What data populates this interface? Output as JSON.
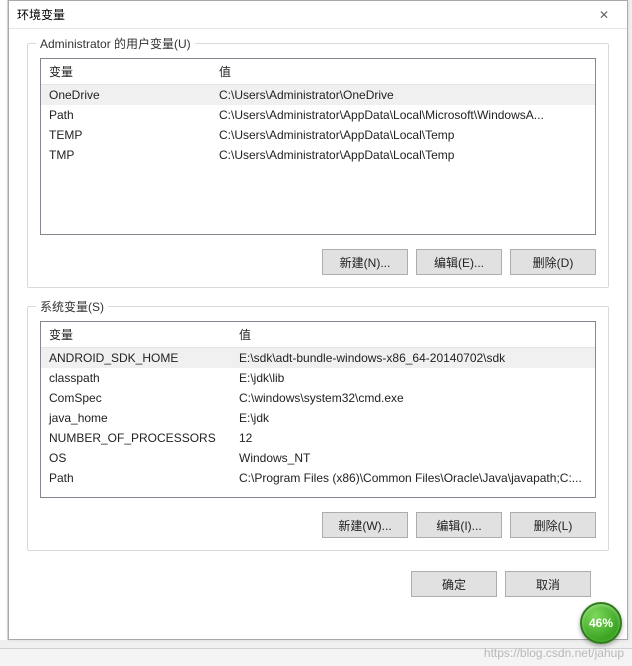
{
  "dialog": {
    "title": "环境变量",
    "close_glyph": "✕"
  },
  "user_section": {
    "legend": "Administrator 的用户变量(U)",
    "col_var": "变量",
    "col_val": "值",
    "rows": [
      {
        "name": "OneDrive",
        "value": "C:\\Users\\Administrator\\OneDrive"
      },
      {
        "name": "Path",
        "value": "C:\\Users\\Administrator\\AppData\\Local\\Microsoft\\WindowsA..."
      },
      {
        "name": "TEMP",
        "value": "C:\\Users\\Administrator\\AppData\\Local\\Temp"
      },
      {
        "name": "TMP",
        "value": "C:\\Users\\Administrator\\AppData\\Local\\Temp"
      }
    ],
    "buttons": {
      "new": "新建(N)...",
      "edit": "编辑(E)...",
      "delete": "删除(D)"
    }
  },
  "system_section": {
    "legend": "系统变量(S)",
    "col_var": "变量",
    "col_val": "值",
    "rows": [
      {
        "name": "ANDROID_SDK_HOME",
        "value": "E:\\sdk\\adt-bundle-windows-x86_64-20140702\\sdk"
      },
      {
        "name": "classpath",
        "value": "E:\\jdk\\lib"
      },
      {
        "name": "ComSpec",
        "value": "C:\\windows\\system32\\cmd.exe"
      },
      {
        "name": "java_home",
        "value": "E:\\jdk"
      },
      {
        "name": "NUMBER_OF_PROCESSORS",
        "value": "12"
      },
      {
        "name": "OS",
        "value": "Windows_NT"
      },
      {
        "name": "Path",
        "value": "C:\\Program Files (x86)\\Common Files\\Oracle\\Java\\javapath;C:..."
      }
    ],
    "buttons": {
      "new": "新建(W)...",
      "edit": "编辑(I)...",
      "delete": "删除(L)"
    }
  },
  "footer": {
    "ok": "确定",
    "cancel": "取消"
  },
  "badge": "46%",
  "watermark": "https://blog.csdn.net/jahup"
}
